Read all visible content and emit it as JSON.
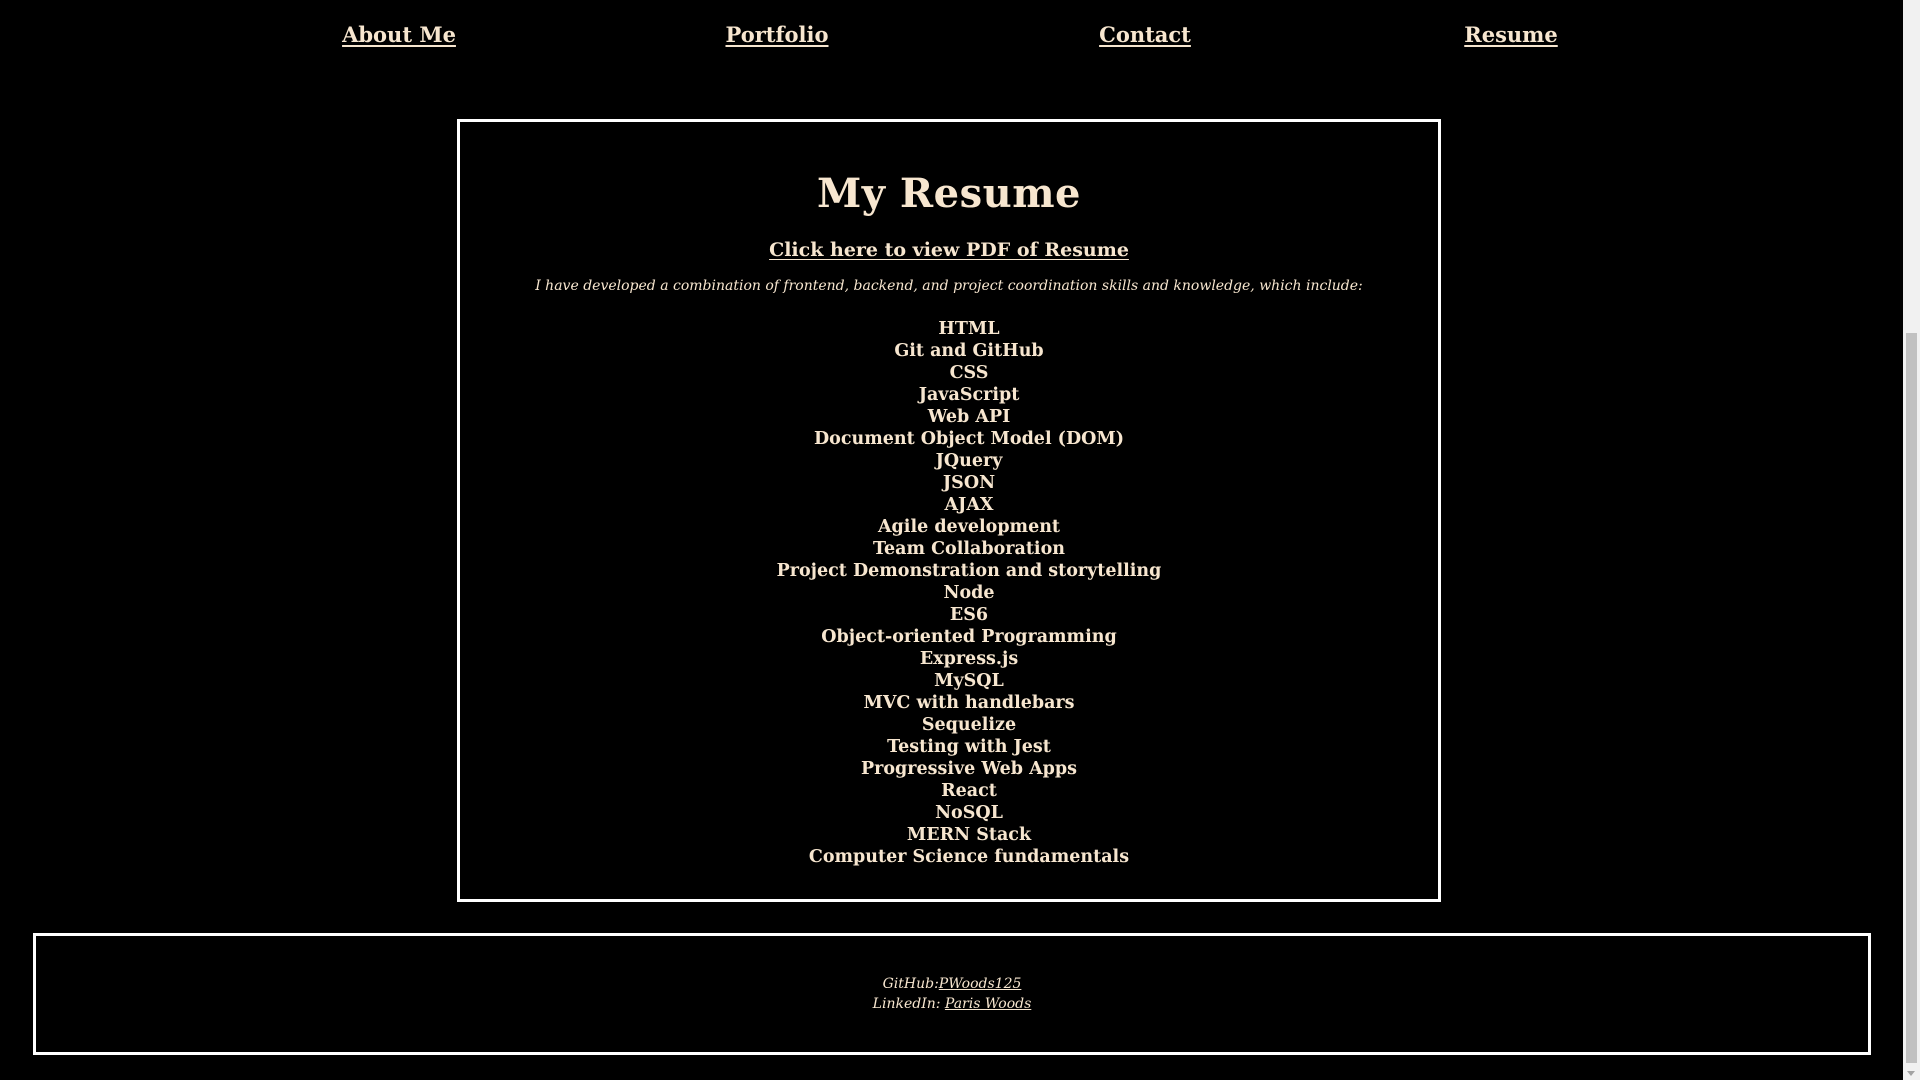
{
  "nav": {
    "items": [
      {
        "label": "About Me"
      },
      {
        "label": "Portfolio"
      },
      {
        "label": "Contact"
      },
      {
        "label": "Resume"
      }
    ]
  },
  "main": {
    "title": "My Resume",
    "pdf_link": "Click here to view PDF of Resume",
    "intro": "I have developed a combination of frontend, backend, and project coordination skills and knowledge, which include:",
    "skills": [
      "HTML",
      "Git and GitHub",
      "CSS",
      "JavaScript",
      "Web API",
      "Document Object Model (DOM)",
      "JQuery",
      "JSON",
      "AJAX",
      "Agile development",
      "Team Collaboration",
      "Project Demonstration and storytelling",
      "Node",
      "ES6",
      "Object-oriented Programming",
      "Express.js",
      "MySQL",
      "MVC with handlebars",
      "Sequelize",
      "Testing with Jest",
      "Progressive Web Apps",
      "React",
      "NoSQL",
      "MERN Stack",
      "Computer Science fundamentals"
    ]
  },
  "footer": {
    "github_label": "GitHub:",
    "github_link": "PWoods125",
    "linkedin_label": "LinkedIn: ",
    "linkedin_link": "Paris Woods"
  },
  "colors": {
    "background": "#000000",
    "text": "#f7e6cf",
    "border": "#ffffff"
  }
}
